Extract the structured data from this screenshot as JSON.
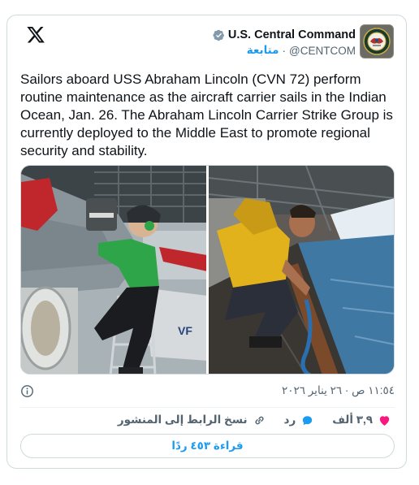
{
  "header": {
    "display_name": "U.S. Central Command",
    "handle": "@CENTCOM",
    "separator": "·",
    "follow_label": "متابعة"
  },
  "tweet": {
    "text": "Sailors aboard USS Abraham Lincoln (CVN 72) perform routine maintenance as the aircraft carrier sails in the Indian Ocean, Jan. 26. The Abraham Lincoln Carrier Strike Group is currently deployed to the Middle East to promote regional security and stability.",
    "timestamp": "١١:٥٤ ص · ٢٦ يناير ٢٠٢٦"
  },
  "media": {
    "left_photo_text": "VF"
  },
  "actions": {
    "likes_count": "٣,٩ ألف",
    "reply_label": "رد",
    "copy_link_label": "نسخ الرابط إلى المنشور"
  },
  "read_replies_label": "قراءة ٤٥٣ ردًا",
  "colors": {
    "accent": "#1d9bf0",
    "like": "#f91880",
    "muted": "#536471",
    "border": "#cfd9de"
  },
  "icons": [
    "x-logo-icon",
    "verified-badge-icon",
    "info-icon",
    "heart-icon",
    "reply-bubble-icon",
    "link-icon"
  ]
}
